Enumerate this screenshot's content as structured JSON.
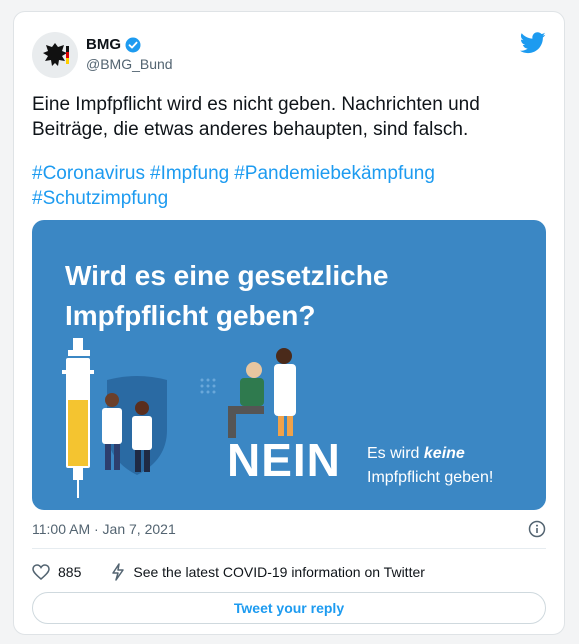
{
  "tweet": {
    "author_name": "BMG",
    "author_handle": "@BMG_Bund",
    "text_line1": "Eine Impfpflicht wird es nicht geben. Nachrichten und",
    "text_line2": "Beiträge, die etwas anderes behaupten, sind falsch.",
    "hashtags": [
      "#Coronavirus",
      "#Impfung",
      "#Pandemiebekämpfung",
      "#Schutzimpfung"
    ],
    "timestamp": "11:00 AM · Jan 7, 2021",
    "like_count": "885",
    "covid_link": "See the latest COVID-19 information on Twitter",
    "reply_button": "Tweet your reply"
  },
  "media": {
    "title_line1": "Wird es eine gesetzliche",
    "title_line2": "Impfpflicht geben?",
    "answer": "NEIN",
    "sub_line1_a": "Es wird ",
    "sub_line1_b": "keine",
    "sub_line2": "Impfpflicht geben!"
  },
  "colors": {
    "link_blue": "#1d9bf0",
    "media_bg": "#3b87c4",
    "text_dark": "#0f1419",
    "text_muted": "#536471"
  },
  "icons": [
    "eagle-icon",
    "verified-icon",
    "twitter-bird-icon",
    "info-icon",
    "heart-icon",
    "lightning-icon"
  ]
}
